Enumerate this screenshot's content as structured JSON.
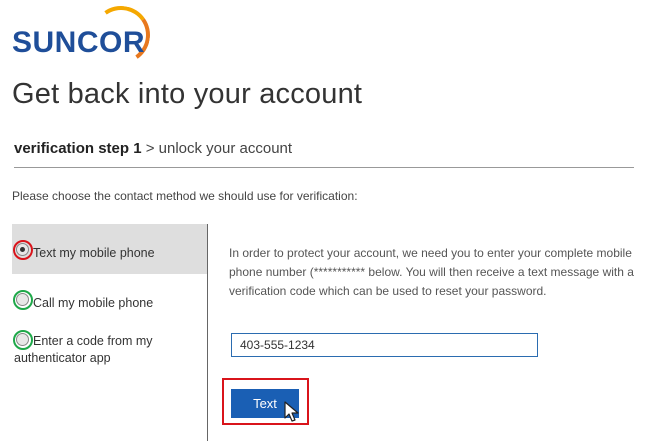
{
  "brand": {
    "logo_text": "SUNCOR",
    "color": "#1f4e99",
    "arc_colors": [
      "#f5a800",
      "#e8781e"
    ]
  },
  "page_title": "Get back into your account",
  "breadcrumb": {
    "step": "verification step 1",
    "separator": ">",
    "next": "unlock your account"
  },
  "instructions": "Please choose the contact method we should use for verification:",
  "contact_methods": [
    {
      "label": "Text my mobile phone",
      "selected": true
    },
    {
      "label": "Call my mobile phone",
      "selected": false
    },
    {
      "label": "Enter a code from my authenticator app",
      "selected": false
    }
  ],
  "info_text": "In order to protect your account, we need you to enter your complete mobile phone number (***********       below. You will then receive a text message with a verification code which can be used to reset your password.",
  "phone_field": {
    "value": "403-555-1234"
  },
  "text_button": {
    "label": "Text"
  },
  "colors": {
    "primary_button": "#1a5fb4",
    "highlight_red": "#d9141b",
    "highlight_green": "#1fa84a",
    "selected_bg": "#dedede"
  },
  "icons": {
    "cursor": "pointer-cursor-icon"
  }
}
